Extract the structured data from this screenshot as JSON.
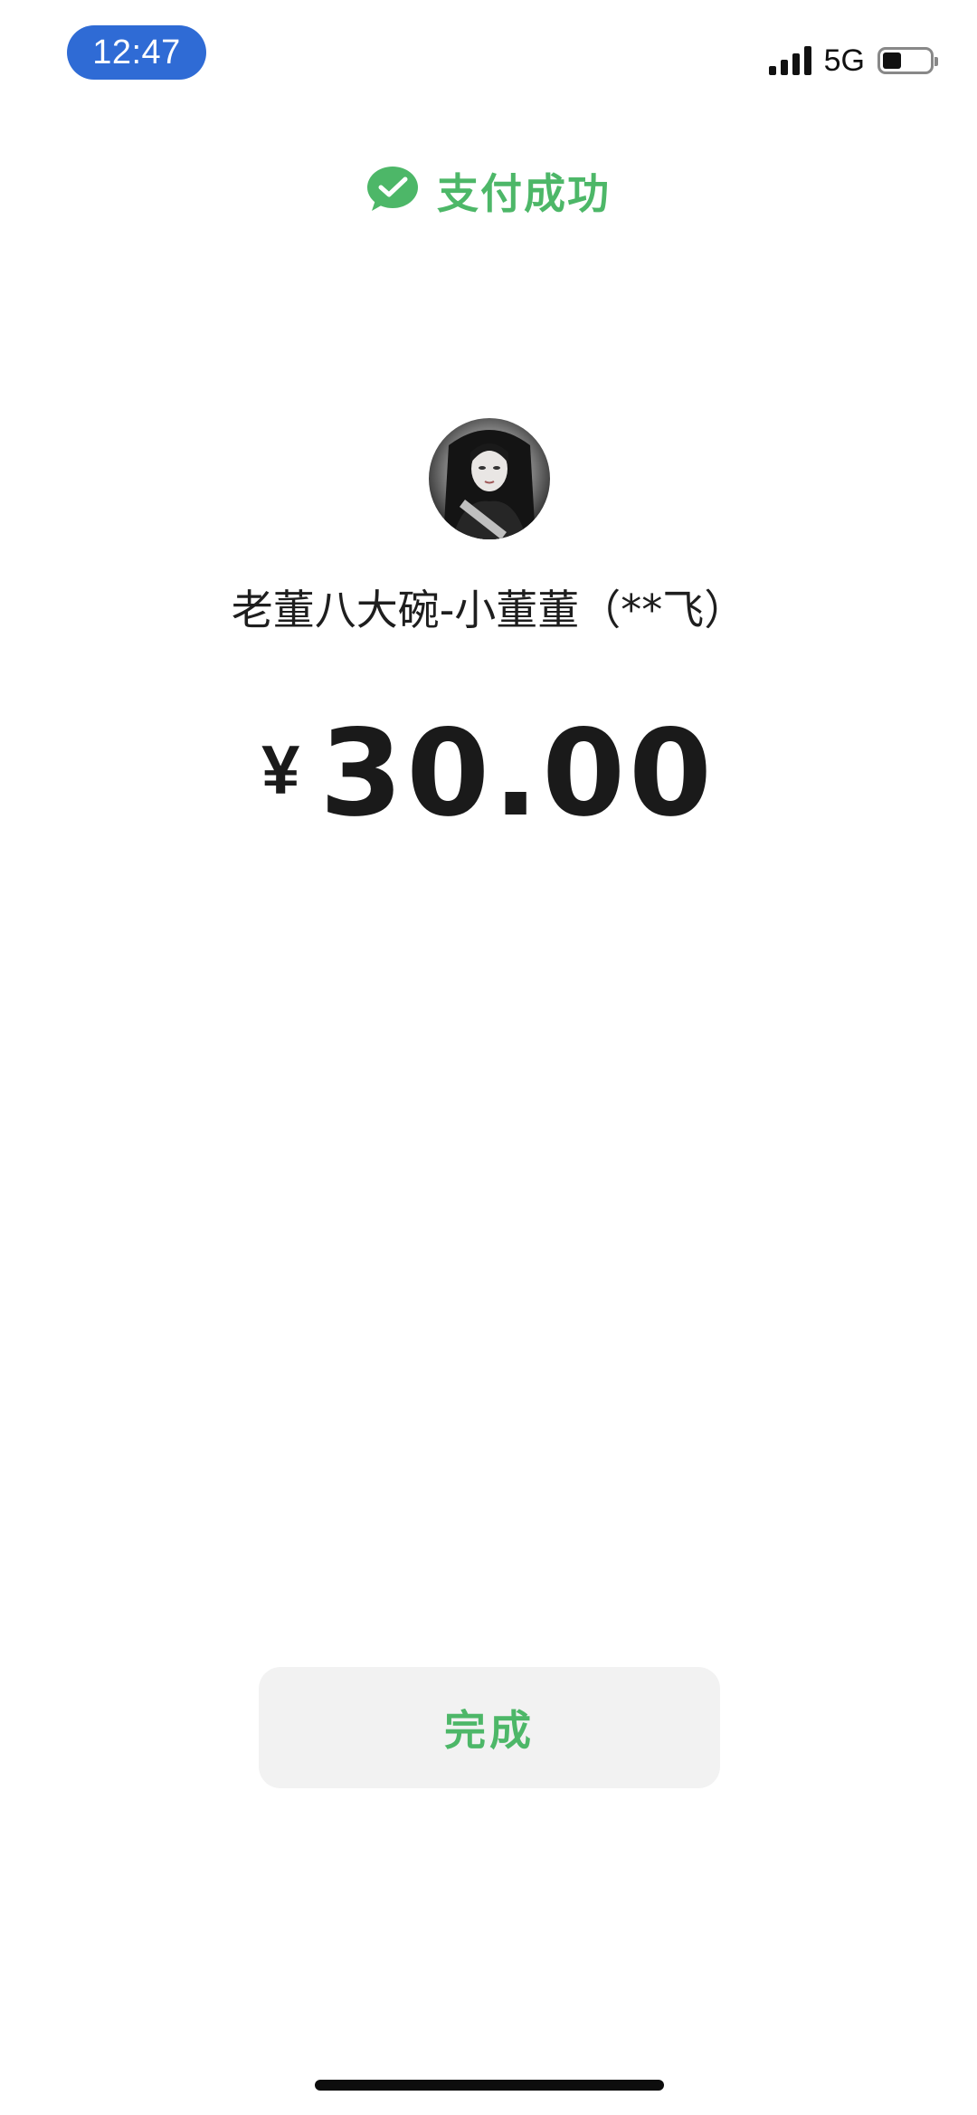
{
  "status_bar": {
    "time": "12:47",
    "network": "5G",
    "signal_bars": 4,
    "battery_level": 0.4
  },
  "header": {
    "title": "支付成功",
    "icon": "wechat-pay-icon"
  },
  "payee": {
    "avatar_icon": "payee-avatar",
    "name": "老董八大碗-小董董（**飞）"
  },
  "amount": {
    "currency": "¥",
    "value": "30.00"
  },
  "done_button": {
    "label": "完成"
  },
  "colors": {
    "accent": "#4db768",
    "time_pill": "#2f6bd5",
    "button_bg": "#f2f2f2",
    "text": "#1a1a1a"
  }
}
